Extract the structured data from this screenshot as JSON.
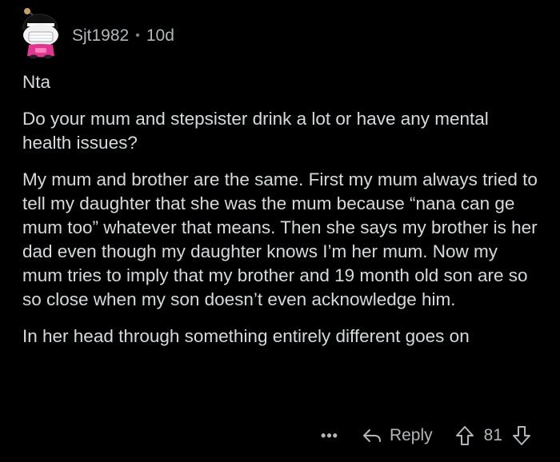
{
  "comment": {
    "author": "Sjt1982",
    "separator": "•",
    "age": "10d",
    "paragraphs": [
      "Nta",
      "Do your mum and stepsister drink a lot or have any mental health issues?",
      "My mum and brother are the same. First my mum always tried to tell my daughter that she was the mum because “nana can ge mum too” whatever that means. Then she says my brother is her dad even though my daughter knows I’m her mum. Now my mum tries to imply that my brother and 19 month old son are so so close when my son doesn’t even acknowledge him.",
      "In her head through something entirely different goes on"
    ],
    "more_label": "•••",
    "reply_label": "Reply",
    "score": "81"
  },
  "colors": {
    "background": "#000000",
    "text": "#d7dadc",
    "meta": "#b3b7ba",
    "avatar_pink": "#e0368f"
  },
  "icons": {
    "avatar": "snoo-avatar",
    "reply": "reply-arrow-icon",
    "upvote": "upvote-arrow-icon",
    "downvote": "downvote-arrow-icon"
  }
}
